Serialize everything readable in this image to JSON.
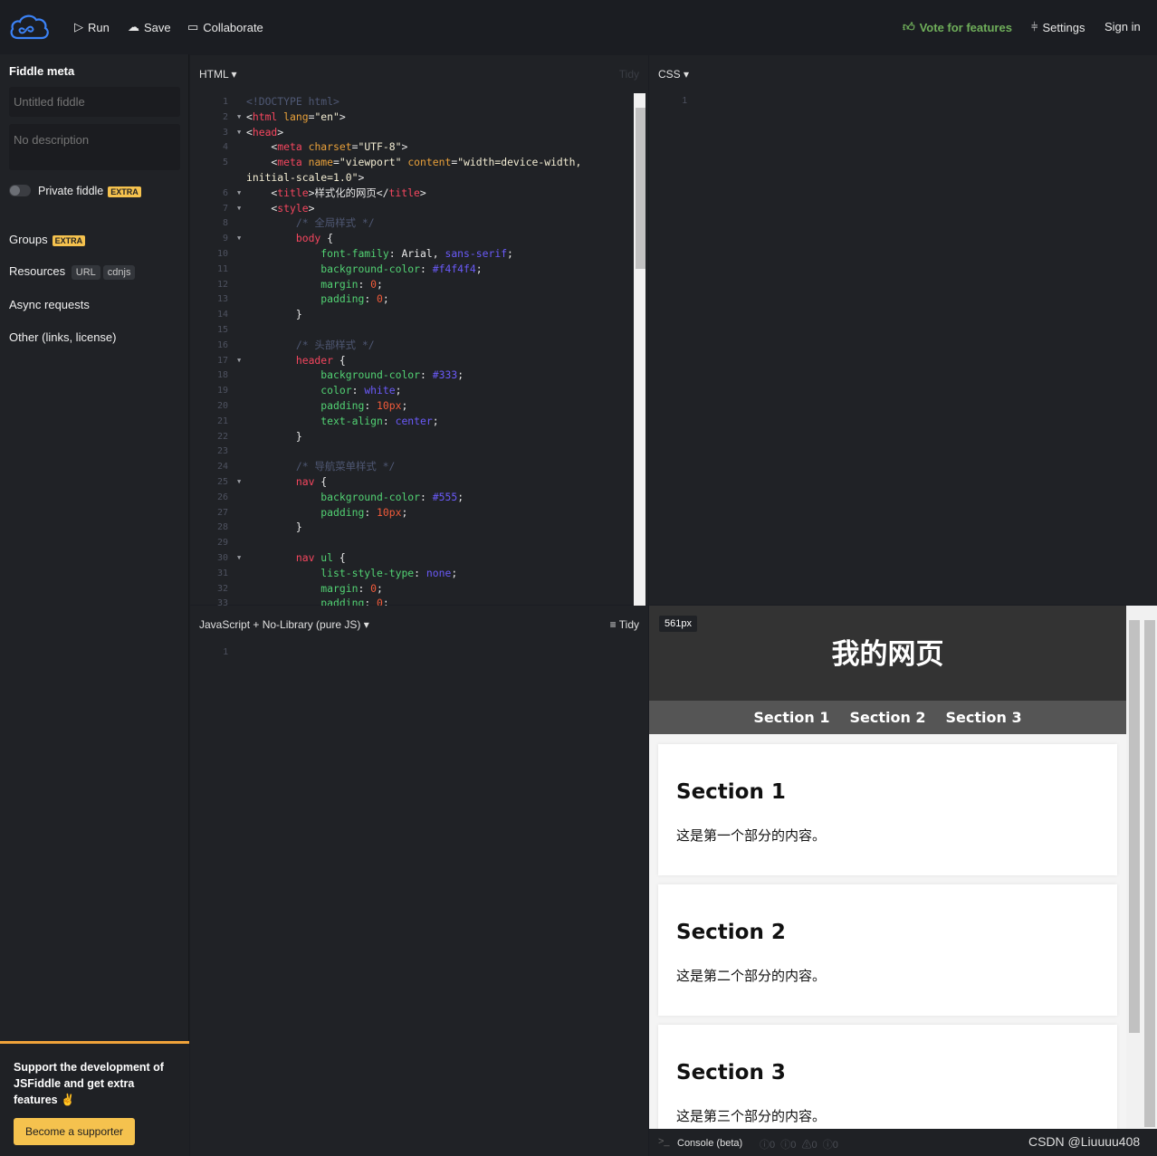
{
  "topbar": {
    "run": "Run",
    "save": "Save",
    "collaborate": "Collaborate",
    "vote": "Vote for features",
    "settings": "Settings",
    "signin": "Sign in",
    "vote_color": "#6fae5a",
    "logo_color": "#3b82f6"
  },
  "sidebar": {
    "title": "Fiddle meta",
    "name_placeholder": "Untitled fiddle",
    "desc_placeholder": "No description",
    "private": "Private fiddle",
    "extra": "EXTRA",
    "groups": "Groups",
    "resources": "Resources",
    "url": "URL",
    "cdnjs": "cdnjs",
    "async": "Async requests",
    "other": "Other (links, license)",
    "support_text": "Support the development of JSFiddle and get extra features ✌",
    "support_button": "Become a supporter"
  },
  "html_panel": {
    "label": "HTML ▾",
    "tidy": "Tidy",
    "lines": [
      {
        "n": "1",
        "f": false,
        "s": [
          [
            "c",
            "<!DOCTYPE html>"
          ]
        ]
      },
      {
        "n": "2",
        "f": true,
        "s": [
          [
            "w",
            "<"
          ],
          [
            "t",
            "html"
          ],
          [
            "a",
            " lang"
          ],
          [
            "w",
            "="
          ],
          [
            "s",
            "\"en\""
          ],
          [
            "w",
            ">"
          ]
        ]
      },
      {
        "n": "3",
        "f": true,
        "s": [
          [
            "w",
            "<"
          ],
          [
            "t",
            "head"
          ],
          [
            "w",
            ">"
          ]
        ]
      },
      {
        "n": "4",
        "f": false,
        "s": [
          [
            "w",
            "    <"
          ],
          [
            "t",
            "meta"
          ],
          [
            "a",
            " charset"
          ],
          [
            "w",
            "="
          ],
          [
            "s",
            "\"UTF-8\""
          ],
          [
            "w",
            ">"
          ]
        ]
      },
      {
        "n": "5",
        "f": false,
        "s": [
          [
            "w",
            "    <"
          ],
          [
            "t",
            "meta"
          ],
          [
            "a",
            " name"
          ],
          [
            "w",
            "="
          ],
          [
            "s",
            "\"viewport\""
          ],
          [
            "a",
            " content"
          ],
          [
            "w",
            "="
          ],
          [
            "s",
            "\"width=device-width,"
          ]
        ]
      },
      {
        "n": "",
        "f": false,
        "s": [
          [
            "s",
            "initial-scale=1.0\""
          ],
          [
            "w",
            ">"
          ]
        ]
      },
      {
        "n": "6",
        "f": true,
        "s": [
          [
            "w",
            "    <"
          ],
          [
            "t",
            "title"
          ],
          [
            "w",
            ">样式化的网页</"
          ],
          [
            "t",
            "title"
          ],
          [
            "w",
            ">"
          ]
        ]
      },
      {
        "n": "7",
        "f": true,
        "s": [
          [
            "w",
            "    <"
          ],
          [
            "t",
            "style"
          ],
          [
            "w",
            ">"
          ]
        ]
      },
      {
        "n": "8",
        "f": false,
        "s": [
          [
            "c",
            "        /* 全局样式 */"
          ]
        ]
      },
      {
        "n": "9",
        "f": true,
        "s": [
          [
            "t",
            "        body"
          ],
          [
            "w",
            " {"
          ]
        ]
      },
      {
        "n": "10",
        "f": false,
        "s": [
          [
            "p",
            "            font-family"
          ],
          [
            "w",
            ": Arial, "
          ],
          [
            "v",
            "sans-serif"
          ],
          [
            "w",
            ";"
          ]
        ]
      },
      {
        "n": "11",
        "f": false,
        "s": [
          [
            "p",
            "            background-color"
          ],
          [
            "w",
            ": "
          ],
          [
            "v",
            "#f4f4f4"
          ],
          [
            "w",
            ";"
          ]
        ]
      },
      {
        "n": "12",
        "f": false,
        "s": [
          [
            "p",
            "            margin"
          ],
          [
            "w",
            ": "
          ],
          [
            "n",
            "0"
          ],
          [
            "w",
            ";"
          ]
        ]
      },
      {
        "n": "13",
        "f": false,
        "s": [
          [
            "p",
            "            padding"
          ],
          [
            "w",
            ": "
          ],
          [
            "n",
            "0"
          ],
          [
            "w",
            ";"
          ]
        ]
      },
      {
        "n": "14",
        "f": false,
        "s": [
          [
            "w",
            "        }"
          ]
        ]
      },
      {
        "n": "15",
        "f": false,
        "s": []
      },
      {
        "n": "16",
        "f": false,
        "s": [
          [
            "c",
            "        /* 头部样式 */"
          ]
        ]
      },
      {
        "n": "17",
        "f": true,
        "s": [
          [
            "t",
            "        header"
          ],
          [
            "w",
            " {"
          ]
        ]
      },
      {
        "n": "18",
        "f": false,
        "s": [
          [
            "p",
            "            background-color"
          ],
          [
            "w",
            ": "
          ],
          [
            "v",
            "#333"
          ],
          [
            "w",
            ";"
          ]
        ]
      },
      {
        "n": "19",
        "f": false,
        "s": [
          [
            "p",
            "            color"
          ],
          [
            "w",
            ": "
          ],
          [
            "v",
            "white"
          ],
          [
            "w",
            ";"
          ]
        ]
      },
      {
        "n": "20",
        "f": false,
        "s": [
          [
            "p",
            "            padding"
          ],
          [
            "w",
            ": "
          ],
          [
            "n",
            "10px"
          ],
          [
            "w",
            ";"
          ]
        ]
      },
      {
        "n": "21",
        "f": false,
        "s": [
          [
            "p",
            "            text-align"
          ],
          [
            "w",
            ": "
          ],
          [
            "v",
            "center"
          ],
          [
            "w",
            ";"
          ]
        ]
      },
      {
        "n": "22",
        "f": false,
        "s": [
          [
            "w",
            "        }"
          ]
        ]
      },
      {
        "n": "23",
        "f": false,
        "s": []
      },
      {
        "n": "24",
        "f": false,
        "s": [
          [
            "c",
            "        /* 导航菜单样式 */"
          ]
        ]
      },
      {
        "n": "25",
        "f": true,
        "s": [
          [
            "t",
            "        nav"
          ],
          [
            "w",
            " {"
          ]
        ]
      },
      {
        "n": "26",
        "f": false,
        "s": [
          [
            "p",
            "            background-color"
          ],
          [
            "w",
            ": "
          ],
          [
            "v",
            "#555"
          ],
          [
            "w",
            ";"
          ]
        ]
      },
      {
        "n": "27",
        "f": false,
        "s": [
          [
            "p",
            "            padding"
          ],
          [
            "w",
            ": "
          ],
          [
            "n",
            "10px"
          ],
          [
            "w",
            ";"
          ]
        ]
      },
      {
        "n": "28",
        "f": false,
        "s": [
          [
            "w",
            "        }"
          ]
        ]
      },
      {
        "n": "29",
        "f": false,
        "s": []
      },
      {
        "n": "30",
        "f": true,
        "s": [
          [
            "t",
            "        nav"
          ],
          [
            "p",
            " ul"
          ],
          [
            "w",
            " {"
          ]
        ]
      },
      {
        "n": "31",
        "f": false,
        "s": [
          [
            "p",
            "            list-style-type"
          ],
          [
            "w",
            ": "
          ],
          [
            "v",
            "none"
          ],
          [
            "w",
            ";"
          ]
        ]
      },
      {
        "n": "32",
        "f": false,
        "s": [
          [
            "p",
            "            margin"
          ],
          [
            "w",
            ": "
          ],
          [
            "n",
            "0"
          ],
          [
            "w",
            ";"
          ]
        ]
      },
      {
        "n": "33",
        "f": false,
        "s": [
          [
            "p",
            "            padding"
          ],
          [
            "w",
            ": "
          ],
          [
            "n",
            "0"
          ],
          [
            "w",
            ";"
          ]
        ]
      }
    ]
  },
  "css_panel": {
    "label": "CSS ▾",
    "line": "1"
  },
  "js_panel": {
    "label": "JavaScript + No-Library (pure JS) ▾",
    "tidy": "Tidy",
    "line": "1"
  },
  "result": {
    "size": "561px",
    "title": "我的网页",
    "nav": [
      "Section 1",
      "Section 2",
      "Section 3"
    ],
    "sections": [
      {
        "h": "Section 1",
        "p": "这是第一个部分的内容。"
      },
      {
        "h": "Section 2",
        "p": "这是第二个部分的内容。"
      },
      {
        "h": "Section 3",
        "p": "这是第三个部分的内容。"
      }
    ]
  },
  "console": {
    "label": "Console (beta)",
    "counts": [
      "0",
      "0",
      "0",
      "0"
    ],
    "watermark": "CSDN @Liuuuu408"
  }
}
